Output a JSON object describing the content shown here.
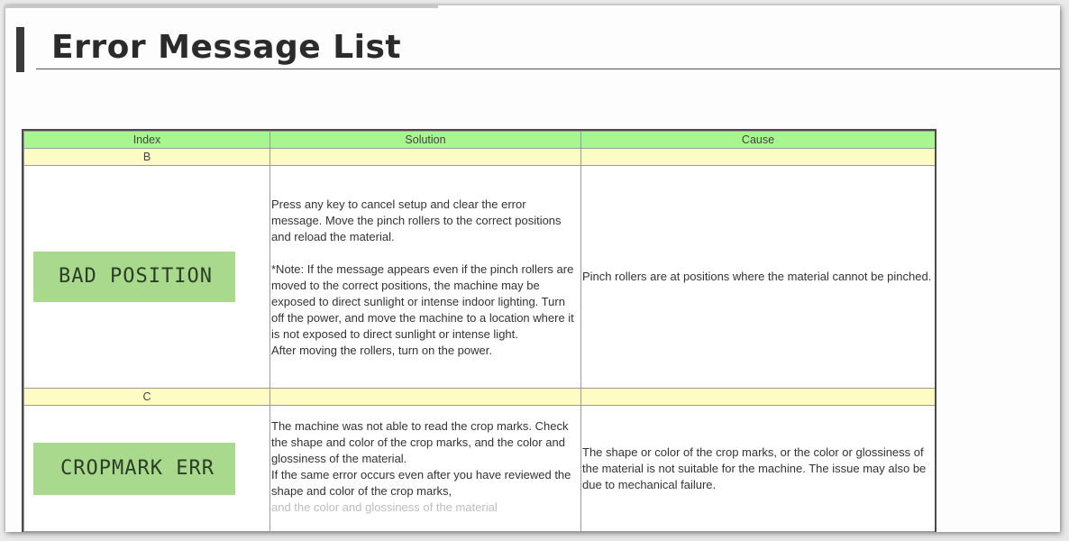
{
  "page": {
    "title": "Error Message List"
  },
  "table": {
    "headers": [
      "Index",
      "Solution",
      "Cause"
    ],
    "groups": [
      {
        "letter": "B",
        "rows": [
          {
            "index": "BAD POSITION",
            "solution": [
              "Press any key to cancel setup and clear the error message. Move the pinch rollers to the correct positions and reload the material.",
              "*Note: If the message appears even if the pinch rollers are moved to the correct positions, the machine may be exposed to direct sunlight or intense indoor lighting. Turn off the power, and move the machine to a location where it is not exposed to direct sunlight or intense light.",
              "After moving the rollers, turn on the power."
            ],
            "cause": "Pinch rollers are at positions where the material cannot be pinched."
          }
        ]
      },
      {
        "letter": "C",
        "rows": [
          {
            "index": "CROPMARK ERR",
            "solution": [
              "The machine was not able to read the crop marks. Check the shape and color of the crop marks, and the color and glossiness of the material.",
              "If the same error occurs even after you have reviewed the shape and color of the crop marks,",
              "and the color and glossiness of the material"
            ],
            "cause": "The shape or color of the crop marks, or the color or glossiness of the material is not suitable for the machine. The issue may also be due to mechanical failure."
          }
        ]
      }
    ]
  },
  "colors": {
    "header_bg": "#a9f58f",
    "letter_row_bg": "#fdfcc4",
    "lcd_bg": "#a8d98c"
  }
}
